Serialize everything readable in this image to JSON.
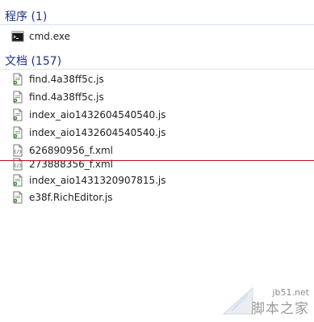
{
  "groups": {
    "programs": {
      "header": "程序 (1)",
      "items": [
        {
          "label": "cmd.exe",
          "icon": "cmd-icon"
        }
      ]
    },
    "documents": {
      "header": "文档 (157)",
      "items": [
        {
          "label": "find.4a38ff5c.js",
          "icon": "script-icon"
        },
        {
          "label": "find.4a38ff5c.js",
          "icon": "script-icon"
        },
        {
          "label": "index_aio1432604540540.js",
          "icon": "script-icon"
        },
        {
          "label": "index_aio1432604540540.js",
          "icon": "script-icon"
        },
        {
          "label": "626890956_f.xml",
          "icon": "xml-icon"
        },
        {
          "label": "273888356_f.xml",
          "icon": "xml-icon"
        },
        {
          "label": "index_aio1431320907815.js",
          "icon": "script-icon"
        },
        {
          "label": "e38f.RichEditor.js",
          "icon": "script-icon"
        }
      ]
    }
  },
  "watermark": {
    "url": "jb51.net",
    "name": "脚本之家"
  },
  "colors": {
    "header": "#1e3287",
    "separator": "#c0101a"
  }
}
